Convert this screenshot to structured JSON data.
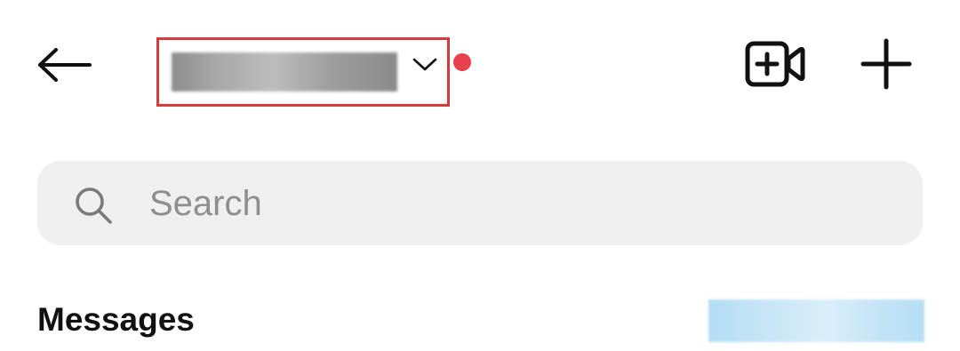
{
  "header": {
    "back_icon": "arrow-left-icon",
    "account_switcher": {
      "chevron_icon": "chevron-down-icon",
      "has_notification": true
    },
    "video_icon": "video-call-add-icon",
    "new_icon": "plus-icon"
  },
  "search": {
    "placeholder": "Search",
    "value": "",
    "icon": "search-icon"
  },
  "messages": {
    "title": "Messages"
  },
  "colors": {
    "highlight_border": "#d63a3f",
    "notification_dot": "#e8404d",
    "search_background": "#efefef",
    "placeholder_text": "#8e8e8e"
  }
}
